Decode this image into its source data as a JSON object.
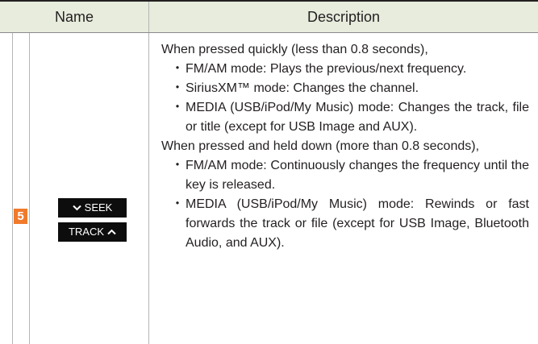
{
  "header": {
    "name": "Name",
    "description": "Description"
  },
  "row": {
    "number": "5",
    "keys": {
      "seek": "SEEK",
      "track": "TRACK"
    },
    "quick_intro": "When pressed quickly (less than 0.8 seconds),",
    "quick_items": [
      "FM/AM mode: Plays the previous/next frequency.",
      "SiriusXM™ mode: Changes the channel.",
      "MEDIA (USB/iPod/My Music) mode: Changes the track, file or title (except for USB Image and AUX)."
    ],
    "held_intro": "When pressed and held down (more than 0.8 seconds),",
    "held_items": [
      "FM/AM mode: Continuously changes the frequency until the key is released.",
      "MEDIA (USB/iPod/My Music) mode: Rewinds or fast forwards the track or file (except for USB Image, Bluetooth Audio, and AUX)."
    ],
    "bullet": "・"
  },
  "colors": {
    "header_bg": "#e7ecdd",
    "badge": "#f07a2c",
    "key_bg": "#0d0d0d"
  },
  "icons": {
    "seek_key": "chevron-down-icon",
    "track_key": "chevron-up-icon"
  }
}
